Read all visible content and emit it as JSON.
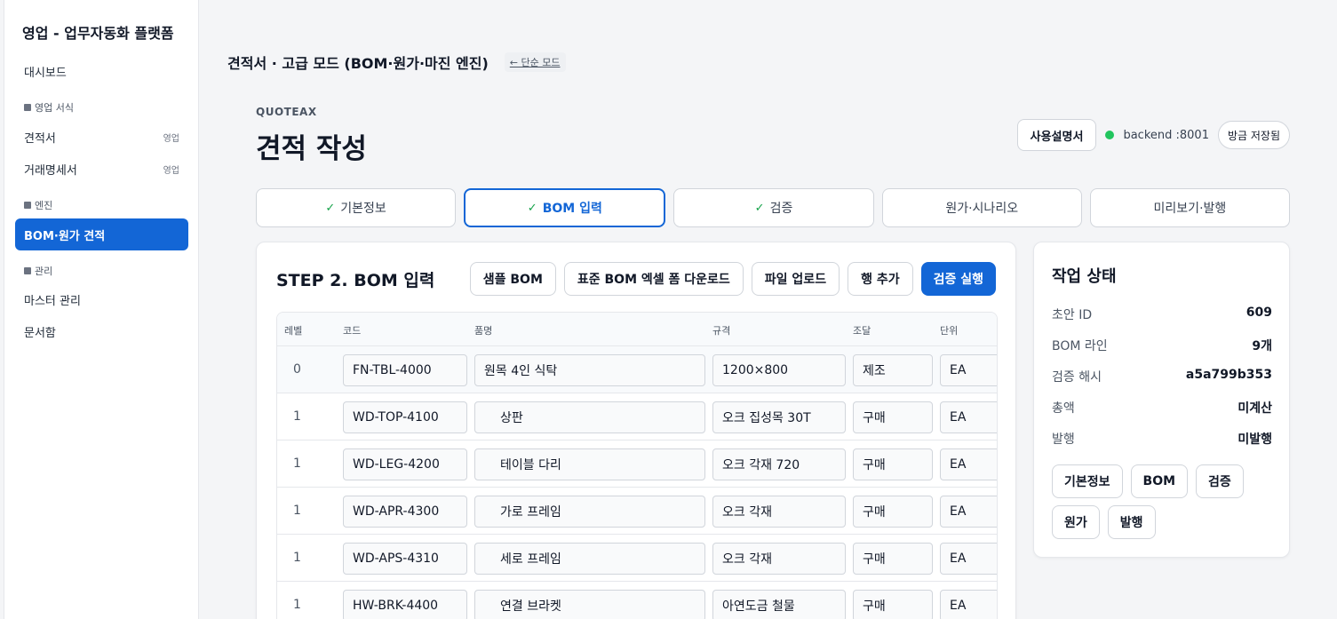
{
  "sidebar": {
    "brand": "영업 - 업무자동화 플랫폼",
    "dashboard": "대시보드",
    "sections": [
      {
        "label": "영업 서식"
      },
      {
        "label": "엔진"
      },
      {
        "label": "관리"
      }
    ],
    "items": {
      "quote": {
        "label": "견적서",
        "tag": "영업"
      },
      "statement": {
        "label": "거래명세서",
        "tag": "영업"
      },
      "bom": {
        "label": "BOM·원가 견적"
      },
      "master": {
        "label": "마스터 관리"
      },
      "docs": {
        "label": "문서함"
      }
    }
  },
  "header": {
    "title": "견적서 · 고급 모드 (BOM·원가·마진 엔진)",
    "simple_link": "← 단순 모드",
    "eyebrow": "QUOTEAX",
    "page_title": "견적 작성",
    "manual_button": "사용설명서",
    "backend": "backend :8001",
    "saved": "방금 저장됨"
  },
  "steps": [
    {
      "label": "기본정보",
      "done": "✓"
    },
    {
      "label": "BOM 입력",
      "done": "✓"
    },
    {
      "label": "검증",
      "done": "✓"
    },
    {
      "label": "원가·시나리오",
      "done": ""
    },
    {
      "label": "미리보기·발행",
      "done": ""
    }
  ],
  "bom": {
    "title": "STEP 2. BOM 입력",
    "actions": {
      "sample": "샘플 BOM",
      "download": "표준 BOM 엑셀 폼 다운로드",
      "upload": "파일 업로드",
      "add_row": "행 추가",
      "validate": "검증 실행"
    },
    "columns": {
      "level": "레벨",
      "code": "코드",
      "name": "품명",
      "spec": "규격",
      "proc": "조달",
      "unit": "단위"
    },
    "rows": [
      {
        "level": "0",
        "code": "FN-TBL-4000",
        "name": "원목 4인 식탁",
        "spec": "1200×800",
        "proc": "제조",
        "unit": "EA"
      },
      {
        "level": "1",
        "code": "WD-TOP-4100",
        "name": "상판",
        "spec": "오크 집성목 30T",
        "proc": "구매",
        "unit": "EA"
      },
      {
        "level": "1",
        "code": "WD-LEG-4200",
        "name": "테이블 다리",
        "spec": "오크 각재 720",
        "proc": "구매",
        "unit": "EA"
      },
      {
        "level": "1",
        "code": "WD-APR-4300",
        "name": "가로 프레임",
        "spec": "오크 각재",
        "proc": "구매",
        "unit": "EA"
      },
      {
        "level": "1",
        "code": "WD-APS-4310",
        "name": "세로 프레임",
        "spec": "오크 각재",
        "proc": "구매",
        "unit": "EA"
      },
      {
        "level": "1",
        "code": "HW-BRK-4400",
        "name": "연결 브라켓",
        "spec": "아연도금 철물",
        "proc": "구매",
        "unit": "EA"
      }
    ]
  },
  "status": {
    "title": "작업 상태",
    "fields": [
      {
        "key": "초안 ID",
        "value": "609"
      },
      {
        "key": "BOM 라인",
        "value": "9개"
      },
      {
        "key": "검증 해시",
        "value": "a5a799b353"
      },
      {
        "key": "총액",
        "value": "미계산"
      },
      {
        "key": "발행",
        "value": "미발행"
      }
    ],
    "chips": [
      "기본정보",
      "BOM",
      "검증",
      "원가",
      "발행"
    ]
  },
  "colors": {
    "accent": "#1366d6",
    "ok": "#22c55e"
  }
}
